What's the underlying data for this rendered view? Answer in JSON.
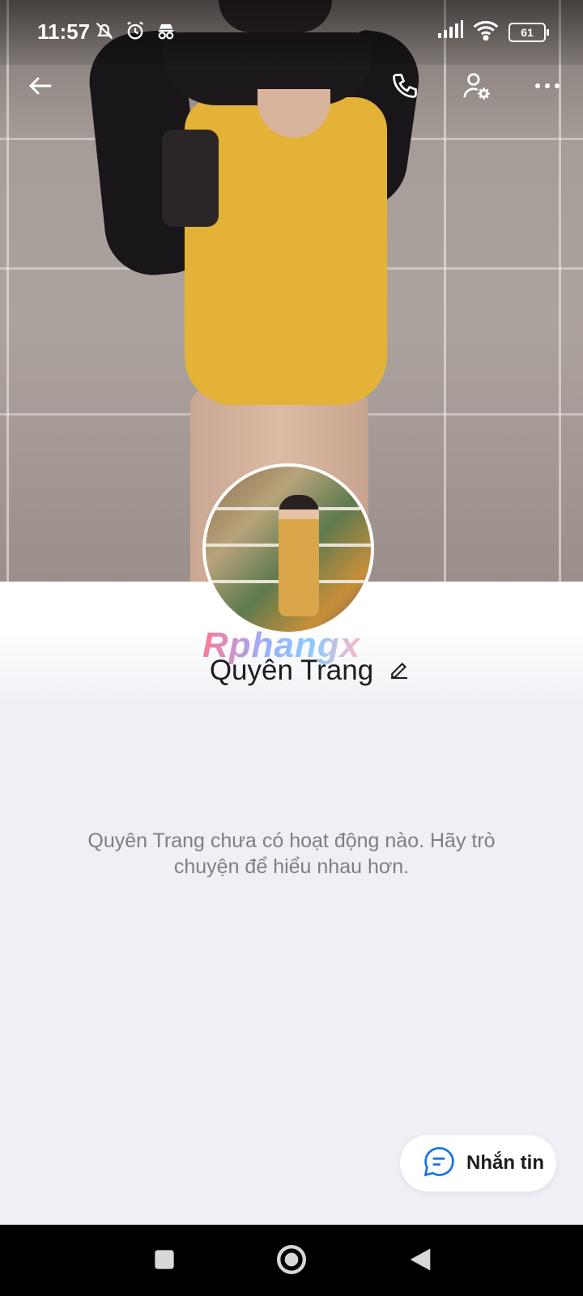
{
  "status_bar": {
    "time": "11:57",
    "battery": "61",
    "left_icons": [
      "mute-icon",
      "alarm-icon",
      "incognito-icon"
    ],
    "right_icons": [
      "signal-icon",
      "wifi-icon",
      "battery-icon"
    ]
  },
  "top_bar": {
    "icons": [
      "back-arrow-icon",
      "phone-icon",
      "user-settings-icon",
      "more-icon"
    ]
  },
  "profile": {
    "name": "Quyên Trang",
    "watermark": "Rphangx",
    "empty_message": "Quyên Trang chưa có hoạt động nào. Hãy trò chuyện để hiểu nhau hơn."
  },
  "message_button": {
    "label": "Nhắn tin",
    "icon": "chat-bubble-icon",
    "accent": "#1a73e8"
  },
  "nav_bar": {
    "icons": [
      "recents-square-icon",
      "home-circle-icon",
      "back-triangle-icon"
    ]
  }
}
